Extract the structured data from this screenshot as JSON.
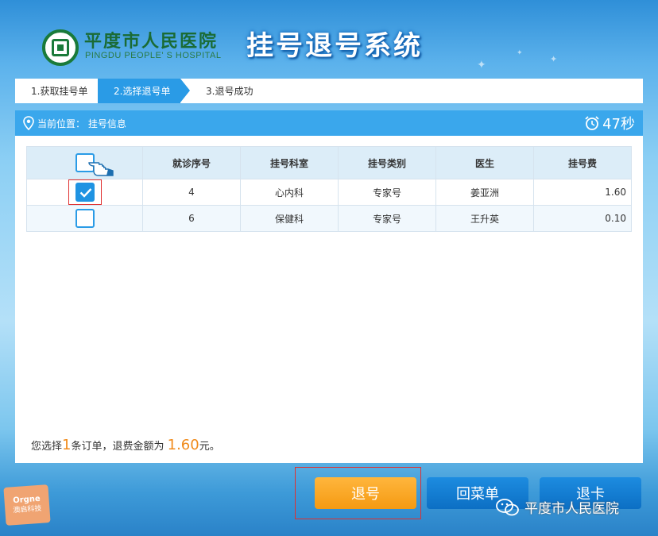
{
  "header": {
    "hospital_name_cn": "平度市人民医院",
    "hospital_name_en": "PINGDU PEOPLE' S HOSPITAL",
    "system_title": "挂号退号系统"
  },
  "steps": [
    {
      "label": "1.获取挂号单"
    },
    {
      "label": "2.选择退号单"
    },
    {
      "label": "3.退号成功"
    }
  ],
  "location": {
    "text": "当前位置： 挂号信息",
    "icon": "location-pin-icon"
  },
  "timer": {
    "text": "47秒",
    "icon": "alarm-clock-icon"
  },
  "table": {
    "columns": [
      "就诊序号",
      "挂号科室",
      "挂号类别",
      "医生",
      "挂号费"
    ],
    "rows": [
      {
        "checked": true,
        "seq": "4",
        "dept": "心内科",
        "type": "专家号",
        "doctor": "姜亚洲",
        "fee": "1.60"
      },
      {
        "checked": false,
        "seq": "6",
        "dept": "保健科",
        "type": "专家号",
        "doctor": "王升英",
        "fee": "0.10"
      }
    ]
  },
  "summary": {
    "prefix": "您选择",
    "count": "1",
    "middle": "条订单，退费金额为",
    "amount": "1.60",
    "suffix": "元。"
  },
  "buttons": {
    "refund": "退号",
    "menu": "回菜单",
    "card": "退卡"
  },
  "brand": {
    "en": "Orgne",
    "cn": "澳启科技"
  },
  "watermark": {
    "text": "平度市人民医院",
    "icon": "wechat-icon"
  },
  "colors": {
    "accent_blue": "#2a9be6",
    "orange": "#f59a12",
    "header_green": "#1a6b35",
    "highlight_red": "#e03030"
  }
}
